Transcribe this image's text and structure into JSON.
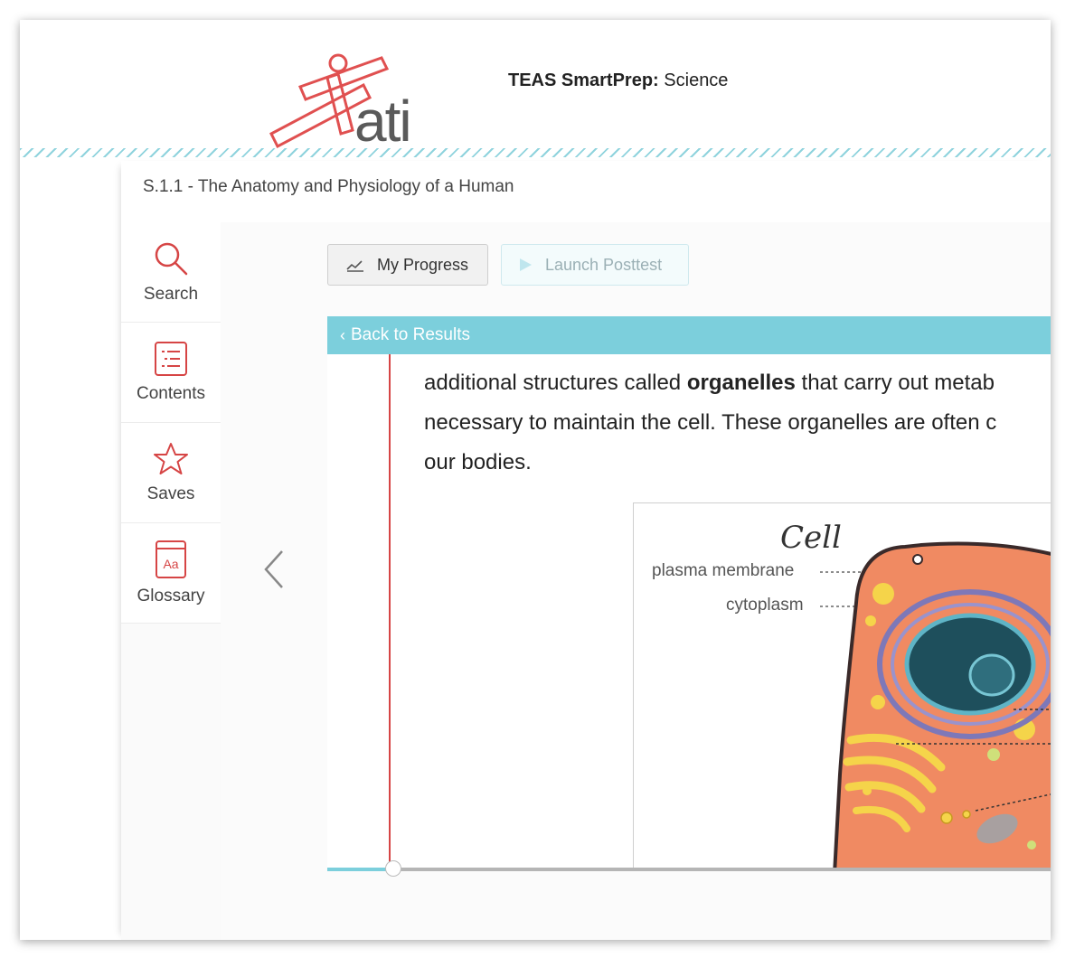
{
  "header": {
    "logo_text": "ati",
    "product": "TEAS SmartPrep:",
    "subject": "Science"
  },
  "breadcrumb": "S.1.1 - The Anatomy and Physiology of a Human",
  "sidebar": {
    "items": [
      {
        "label": "Search",
        "icon": "search-icon"
      },
      {
        "label": "Contents",
        "icon": "list-icon"
      },
      {
        "label": "Saves",
        "icon": "star-icon"
      },
      {
        "label": "Glossary",
        "icon": "book-icon",
        "icon_text": "Aa"
      }
    ]
  },
  "toolbar": {
    "progress_label": "My Progress",
    "launch_label": "Launch Posttest"
  },
  "back_label": "Back to Results",
  "reading": {
    "line1_pre": "additional structures called ",
    "line1_bold": "organelles",
    "line1_post": " that carry out metab",
    "line2": "necessary to maintain the cell. These organelles are often c",
    "line3": "our bodies."
  },
  "figure": {
    "title": "Cell",
    "labels": [
      "plasma membrane",
      "cytoplasm"
    ]
  },
  "progress": {
    "fraction": 0.08
  },
  "colors": {
    "accent": "#7ccfdc",
    "brand_red": "#d64545",
    "cell_body": "#f08a62",
    "nucleus": "#1e4f5c"
  }
}
